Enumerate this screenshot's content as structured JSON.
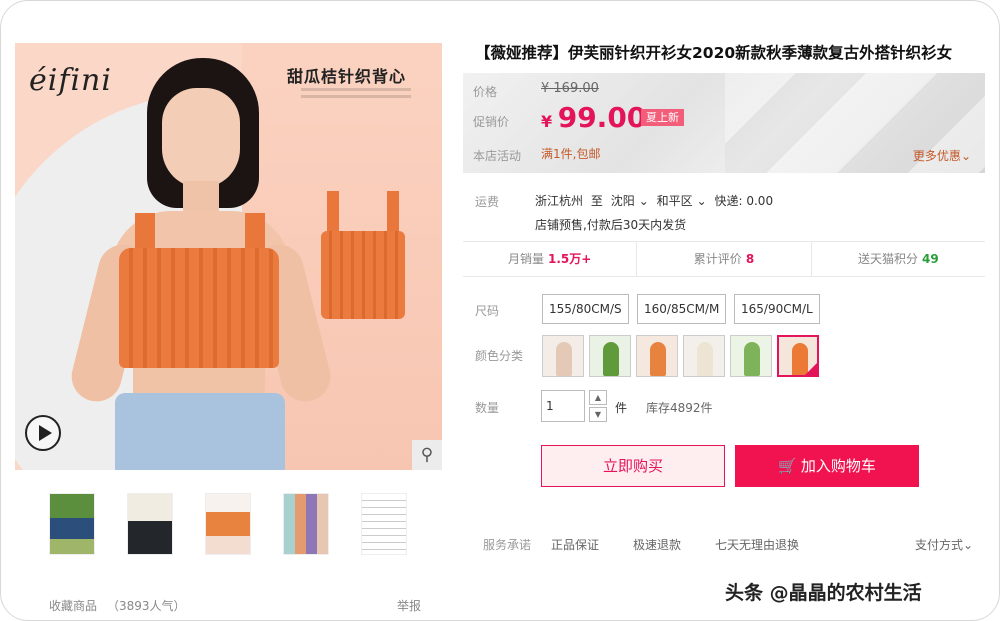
{
  "gallery": {
    "brand_logo": "éifini",
    "promo_title": "甜瓜桔针织背心",
    "thumbnails": [
      "thumb-1",
      "thumb-2",
      "thumb-3",
      "thumb-4",
      "thumb-5"
    ],
    "favorite_label": "收藏商品",
    "favorite_count": "（3893人气）",
    "report_label": "举报"
  },
  "product": {
    "title": "【薇娅推荐】伊芙丽针织开衫女2020新款秋季薄款复古外搭针织衫女"
  },
  "price": {
    "orig_label": "价格",
    "orig_value": "¥ 169.00",
    "sale_label": "促销价",
    "yen": "¥",
    "sale_value": "99.00",
    "badge": "夏上新",
    "activity_label": "本店活动",
    "activity_value": "满1件,包邮",
    "more_offers": "更多优惠"
  },
  "shipping": {
    "label": "运费",
    "from": "浙江杭州",
    "to_word": "至",
    "to_city": "沈阳",
    "to_district": "和平区",
    "fee": "快递: 0.00",
    "presale": "店铺预售,付款后30天内发货"
  },
  "stats": {
    "monthly_label": "月销量",
    "monthly_value": "1.5万+",
    "reviews_label": "累计评价",
    "reviews_value": "8",
    "points_label": "送天猫积分",
    "points_value": "49"
  },
  "options": {
    "size_label": "尺码",
    "sizes": [
      "155/80CM/S",
      "160/85CM/M",
      "165/90CM/L"
    ],
    "color_label": "颜色分类",
    "selected_color_index": 6,
    "qty_label": "数量",
    "qty_value": "1",
    "unit": "件",
    "stock": "库存4892件"
  },
  "actions": {
    "buy_now": "立即购买",
    "add_cart": "加入购物车"
  },
  "services": {
    "label": "服务承诺",
    "items": [
      "正品保证",
      "极速退款",
      "七天无理由退换"
    ],
    "payment": "支付方式"
  },
  "watermark": "头条 @晶晶的农村生活",
  "colors": {
    "accent": "#e4145a",
    "button_red": "#f0134f",
    "activity": "#c4592a"
  }
}
